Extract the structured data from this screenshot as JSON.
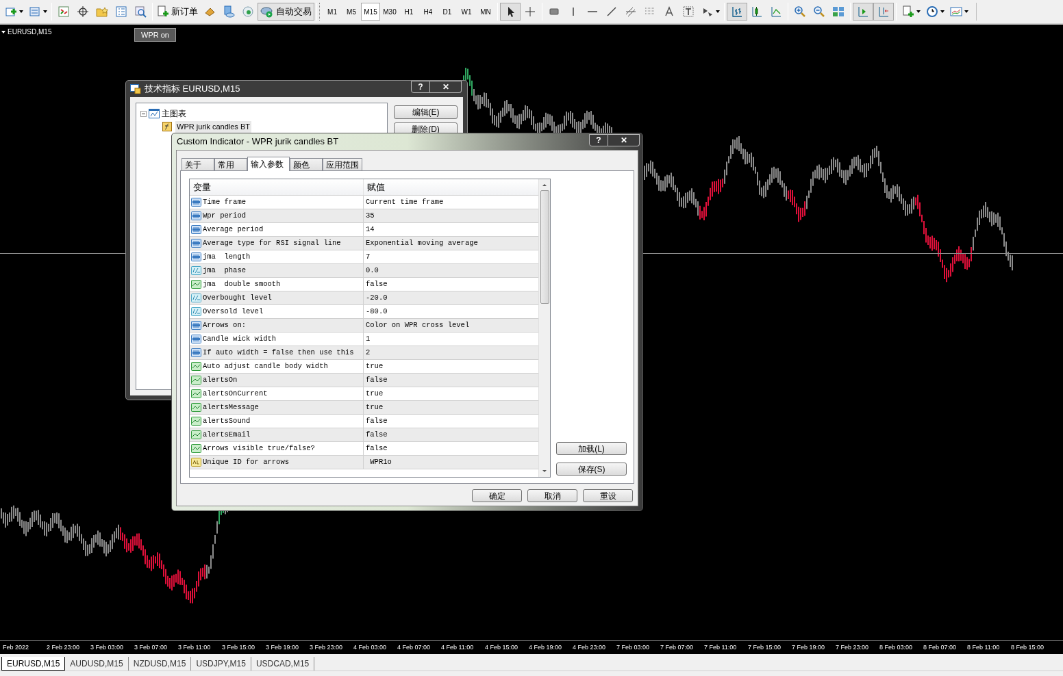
{
  "toolbar": {
    "new_order": "新订单",
    "auto_trading": "自动交易",
    "timeframes": [
      {
        "label": "M1",
        "selected": false
      },
      {
        "label": "M5",
        "selected": false
      },
      {
        "label": "M15",
        "selected": true
      },
      {
        "label": "M30",
        "selected": false
      },
      {
        "label": "H1",
        "selected": false
      },
      {
        "label": "H4",
        "selected": false
      },
      {
        "label": "D1",
        "selected": false
      },
      {
        "label": "W1",
        "selected": false
      },
      {
        "label": "MN",
        "selected": false
      }
    ]
  },
  "chart": {
    "symbol": "EURUSD,M15",
    "badge": "WPR on",
    "time_axis": [
      "Feb 2022",
      "2 Feb 23:00",
      "3 Feb 03:00",
      "3 Feb 07:00",
      "3 Feb 11:00",
      "3 Feb 15:00",
      "3 Feb 19:00",
      "3 Feb 23:00",
      "4 Feb 03:00",
      "4 Feb 07:00",
      "4 Feb 11:00",
      "4 Feb 15:00",
      "4 Feb 19:00",
      "4 Feb 23:00",
      "7 Feb 03:00",
      "7 Feb 07:00",
      "7 Feb 11:00",
      "7 Feb 15:00",
      "7 Feb 19:00",
      "7 Feb 23:00",
      "8 Feb 03:00",
      "8 Feb 07:00",
      "8 Feb 11:00",
      "8 Feb 15:00"
    ]
  },
  "chart_tabs": [
    {
      "label": "EURUSD,M15",
      "selected": true
    },
    {
      "label": "AUDUSD,M15",
      "selected": false
    },
    {
      "label": "NZDUSD,M15",
      "selected": false
    },
    {
      "label": "USDJPY,M15",
      "selected": false
    },
    {
      "label": "USDCAD,M15",
      "selected": false
    }
  ],
  "indicators_dialog": {
    "title": "技术指标 EURUSD,M15",
    "help": "?",
    "close": "✕",
    "tree": [
      {
        "label": "主图表",
        "expanded": true,
        "children": [
          {
            "label": "WPR  jurik candles BT",
            "selected": true
          }
        ]
      }
    ],
    "buttons": [
      "编辑(E)",
      "删除(D)"
    ]
  },
  "custom_indicator_dialog": {
    "title": "Custom Indicator - WPR  jurik candles BT",
    "help": "?",
    "close": "✕",
    "tabs": [
      {
        "label": "关于",
        "selected": false
      },
      {
        "label": "常用",
        "selected": false
      },
      {
        "label": "输入参数",
        "selected": true
      },
      {
        "label": "颜色",
        "selected": false
      },
      {
        "label": "应用范围",
        "selected": false
      }
    ],
    "table": {
      "columns": [
        "变量",
        "赋值"
      ],
      "rows": [
        {
          "kind": "int",
          "name": "Time frame",
          "value": "Current time frame"
        },
        {
          "kind": "int",
          "name": "Wpr period",
          "value": "35"
        },
        {
          "kind": "int",
          "name": "Average period",
          "value": "14"
        },
        {
          "kind": "int",
          "name": "Average type for RSI signal line",
          "value": "Exponential moving average"
        },
        {
          "kind": "int",
          "name": "jma  length",
          "value": "7"
        },
        {
          "kind": "double",
          "name": "jma  phase",
          "value": "0.0"
        },
        {
          "kind": "bool",
          "name": "jma  double smooth",
          "value": "false"
        },
        {
          "kind": "double",
          "name": "Overbought level",
          "value": "-20.0"
        },
        {
          "kind": "double",
          "name": "Oversold level",
          "value": "-80.0"
        },
        {
          "kind": "int",
          "name": "Arrows on:",
          "value": "Color on WPR cross level"
        },
        {
          "kind": "int",
          "name": "Candle wick width",
          "value": "1"
        },
        {
          "kind": "int",
          "name": "If auto width = false then use this",
          "value": "2"
        },
        {
          "kind": "bool",
          "name": "Auto adjust candle body width",
          "value": "true"
        },
        {
          "kind": "bool",
          "name": "alertsOn",
          "value": "false"
        },
        {
          "kind": "bool",
          "name": "alertsOnCurrent",
          "value": "true"
        },
        {
          "kind": "bool",
          "name": "alertsMessage",
          "value": "true"
        },
        {
          "kind": "bool",
          "name": "alertsSound",
          "value": "false"
        },
        {
          "kind": "bool",
          "name": "alertsEmail",
          "value": "false"
        },
        {
          "kind": "bool",
          "name": "Arrows visible true/false?",
          "value": "false"
        },
        {
          "kind": "string",
          "name": "Unique ID for arrows",
          "value": " WPR1o"
        }
      ]
    },
    "side_buttons": [
      "加载(L)",
      "保存(S)"
    ],
    "buttons": [
      "确定",
      "取消",
      "重设"
    ]
  }
}
